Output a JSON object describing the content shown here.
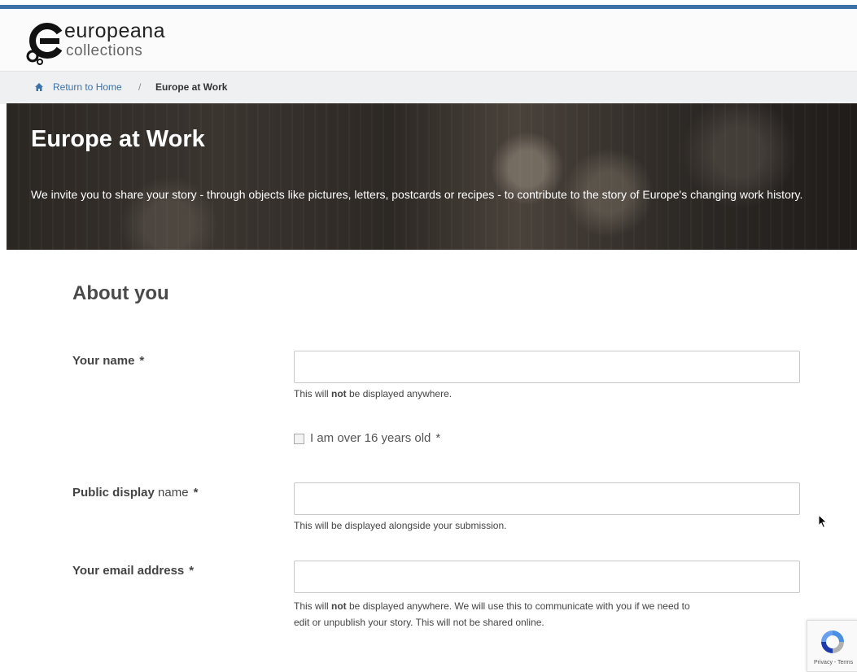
{
  "brand": {
    "name_line1": "europeana",
    "name_line2": "collections"
  },
  "breadcrumb": {
    "home_label": "Return to Home",
    "separator": "/",
    "current": "Europe at Work"
  },
  "hero": {
    "title": "Europe at Work",
    "description": "We invite you to share your story - through objects like pictures, letters, postcards or recipes - to contribute to the story of Europe's changing work history."
  },
  "form": {
    "section_title": "About you",
    "name": {
      "label": "Your name",
      "required_mark": "*",
      "value": "",
      "help_prefix": "This will ",
      "help_bold": "not",
      "help_suffix": " be displayed anywhere."
    },
    "age_check": {
      "label": "I am over 16 years old",
      "required_mark": "*",
      "checked": false
    },
    "display_name": {
      "label_bold": "Public",
      "label_mid": " display",
      "label_end": " name",
      "required_mark": "*",
      "value": "",
      "help": "This will be displayed alongside your submission."
    },
    "email": {
      "label": "Your email address",
      "required_mark": "*",
      "value": "",
      "help_prefix": "This will ",
      "help_bold": "not",
      "help_suffix": " be displayed anywhere. We will use this to communicate with you if we need to",
      "help_line2": "edit or unpublish your story. This will not be shared online."
    }
  },
  "recaptcha": {
    "links": "Privacy - Terms"
  },
  "colors": {
    "accent": "#3a71a6",
    "hero_text": "#ffffff"
  }
}
